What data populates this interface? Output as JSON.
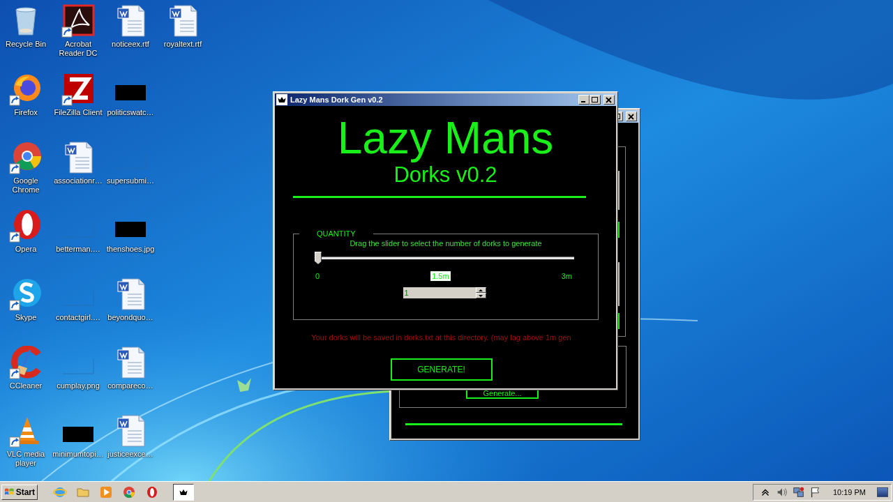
{
  "desktop": {
    "icons": [
      {
        "label": "Recycle Bin",
        "kind": "recycle",
        "shortcut": false
      },
      {
        "label": "Firefox",
        "kind": "firefox",
        "shortcut": true
      },
      {
        "label": "Google Chrome",
        "kind": "chrome",
        "shortcut": true
      },
      {
        "label": "Opera",
        "kind": "opera",
        "shortcut": true
      },
      {
        "label": "Skype",
        "kind": "skype",
        "shortcut": true
      },
      {
        "label": "CCleaner",
        "kind": "ccleaner",
        "shortcut": true
      },
      {
        "label": "VLC media player",
        "kind": "vlc",
        "shortcut": true
      },
      {
        "label": "Acrobat Reader DC",
        "kind": "acrobat",
        "shortcut": true
      },
      {
        "label": "FileZilla Client",
        "kind": "filezilla",
        "shortcut": true
      },
      {
        "label": "associationr…",
        "kind": "word",
        "shortcut": false
      },
      {
        "label": "betterman.…",
        "kind": "blank",
        "shortcut": false
      },
      {
        "label": "contactgirl.…",
        "kind": "blank",
        "shortcut": false
      },
      {
        "label": "cumplay.png",
        "kind": "blank",
        "shortcut": false
      },
      {
        "label": "minimumtopi…",
        "kind": "thumb",
        "shortcut": false
      },
      {
        "label": "noticeex.rtf",
        "kind": "word",
        "shortcut": false
      },
      {
        "label": "politicswatc…",
        "kind": "thumb",
        "shortcut": false
      },
      {
        "label": "supersubmi…",
        "kind": "blank",
        "shortcut": false
      },
      {
        "label": "thenshoes.jpg",
        "kind": "thumb",
        "shortcut": false
      },
      {
        "label": "beyondquo…",
        "kind": "word",
        "shortcut": false
      },
      {
        "label": "compareco…",
        "kind": "word",
        "shortcut": false
      },
      {
        "label": "justiceexce…",
        "kind": "word",
        "shortcut": false
      },
      {
        "label": "royaltext.rtf",
        "kind": "word",
        "shortcut": false
      }
    ]
  },
  "background_window": {
    "generate_button": "Generate..."
  },
  "main_window": {
    "title": "Lazy Mans Dork Gen v0.2",
    "heading": "Lazy Mans",
    "subheading": "Dorks v0.2",
    "quantity": {
      "legend": "QUANTITY",
      "instruction": "Drag the slider to select the number of dorks to generate",
      "slider": {
        "level": 0
      },
      "ticks": [
        {
          "label": "0",
          "highlighted": false
        },
        {
          "label": "1.5m",
          "highlighted": true
        },
        {
          "label": "3m",
          "highlighted": false
        }
      ],
      "spin_value": "1"
    },
    "note": "Your dorks will be saved in dorks.txt at this directory. (may lag above 1m gen",
    "generate_button": "GENERATE!"
  },
  "taskbar": {
    "start": "Start",
    "quick_launch": [
      {
        "kind": "ie"
      },
      {
        "kind": "folder"
      },
      {
        "kind": "media"
      },
      {
        "kind": "chrome"
      },
      {
        "kind": "opera"
      }
    ],
    "tasks": [
      {
        "kind": "crown",
        "selected": true
      }
    ],
    "tray": [
      {
        "kind": "chevron"
      },
      {
        "kind": "speaker"
      },
      {
        "kind": "network"
      },
      {
        "kind": "flag"
      }
    ],
    "clock": "10:19 PM"
  }
}
